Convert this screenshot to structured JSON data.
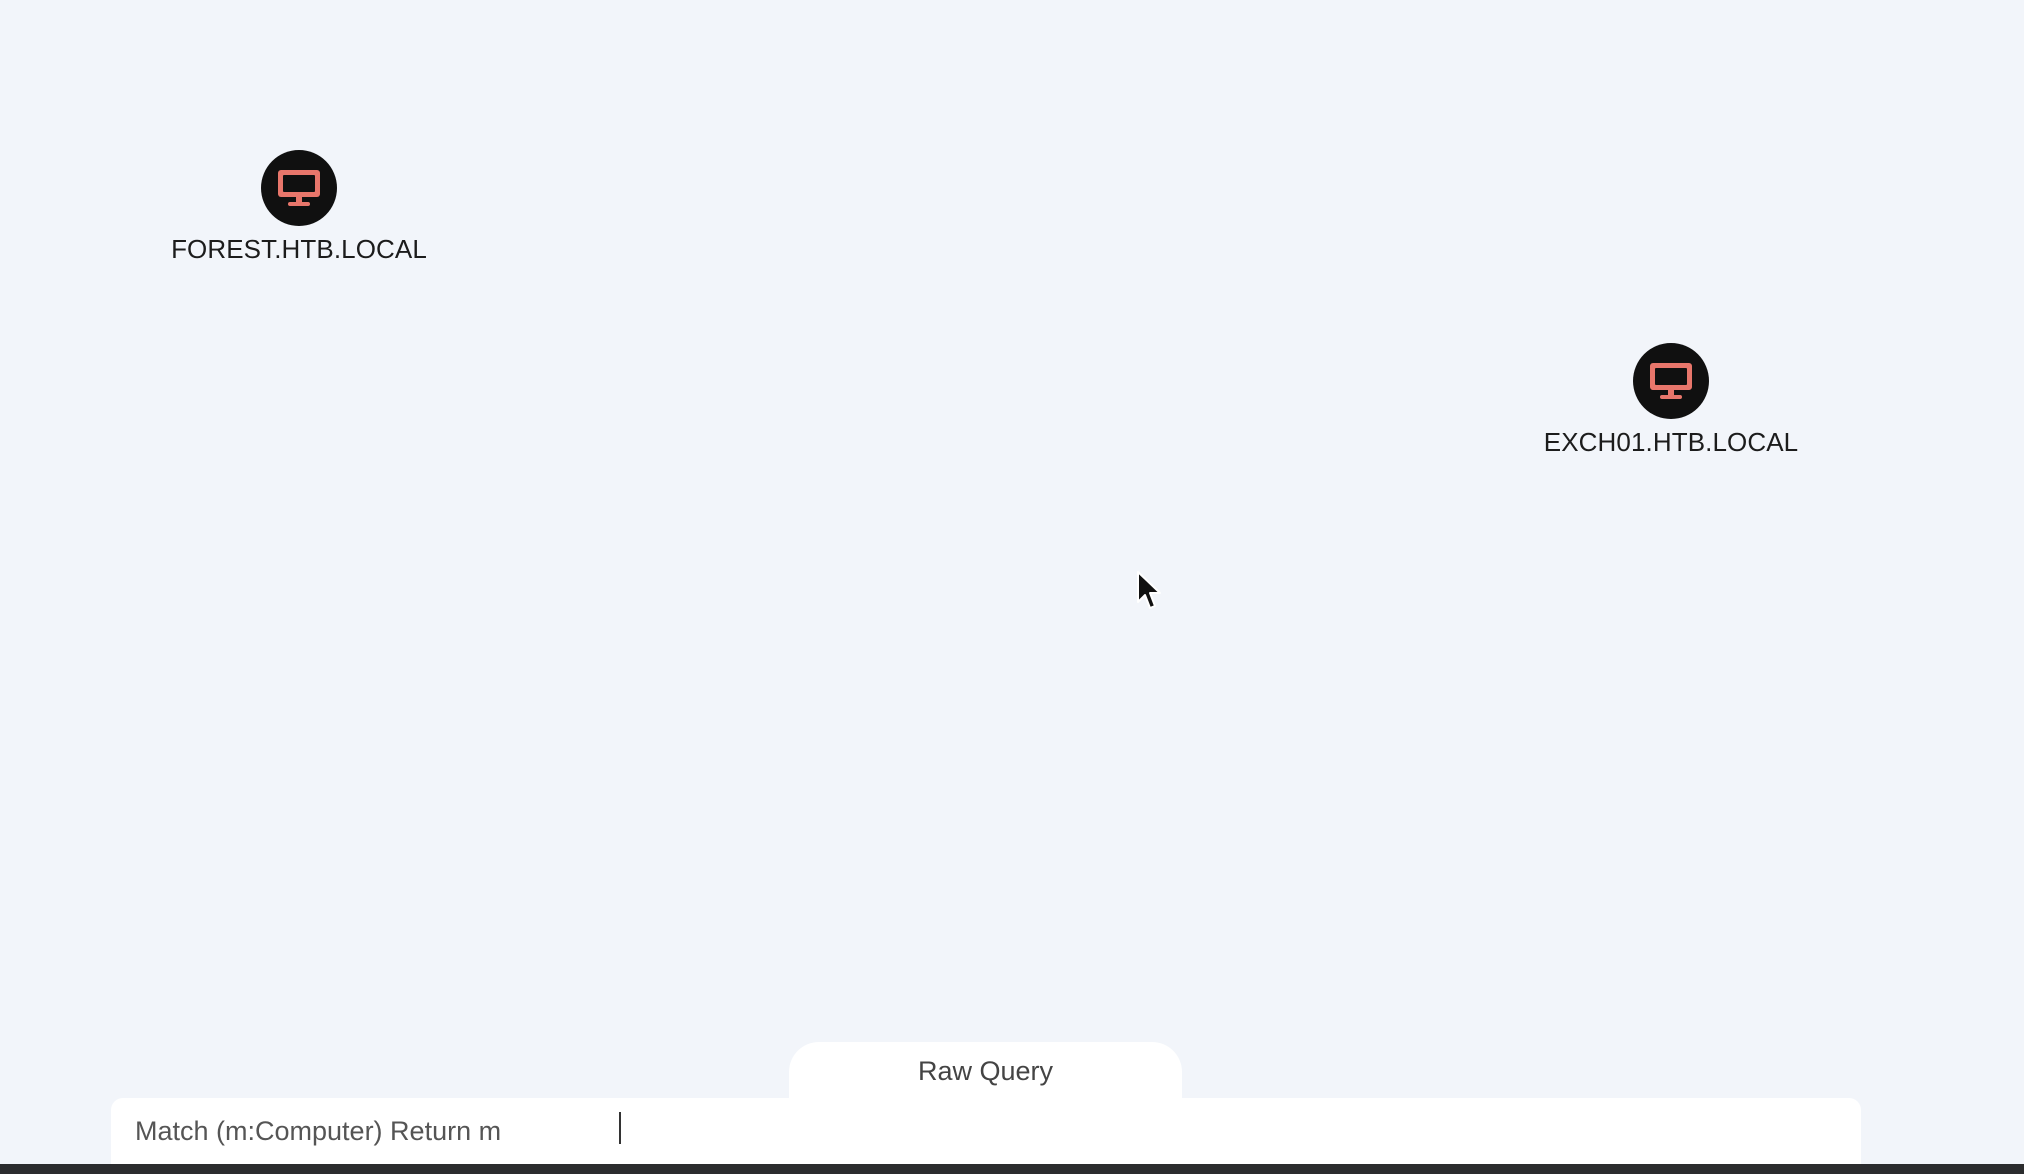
{
  "graph": {
    "nodes": [
      {
        "label": "FOREST.HTB.LOCAL",
        "icon": "monitor-icon"
      },
      {
        "label": "EXCH01.HTB.LOCAL",
        "icon": "monitor-icon"
      }
    ]
  },
  "query_panel": {
    "tab_label": "Raw Query",
    "query_value": "Match (m:Computer) Return m"
  },
  "colors": {
    "canvas_background": "#f2f5fa",
    "node_fill": "#101010",
    "node_icon": "#e8766b",
    "panel_background": "#ffffff",
    "taskbar": "#2b2c2e"
  }
}
